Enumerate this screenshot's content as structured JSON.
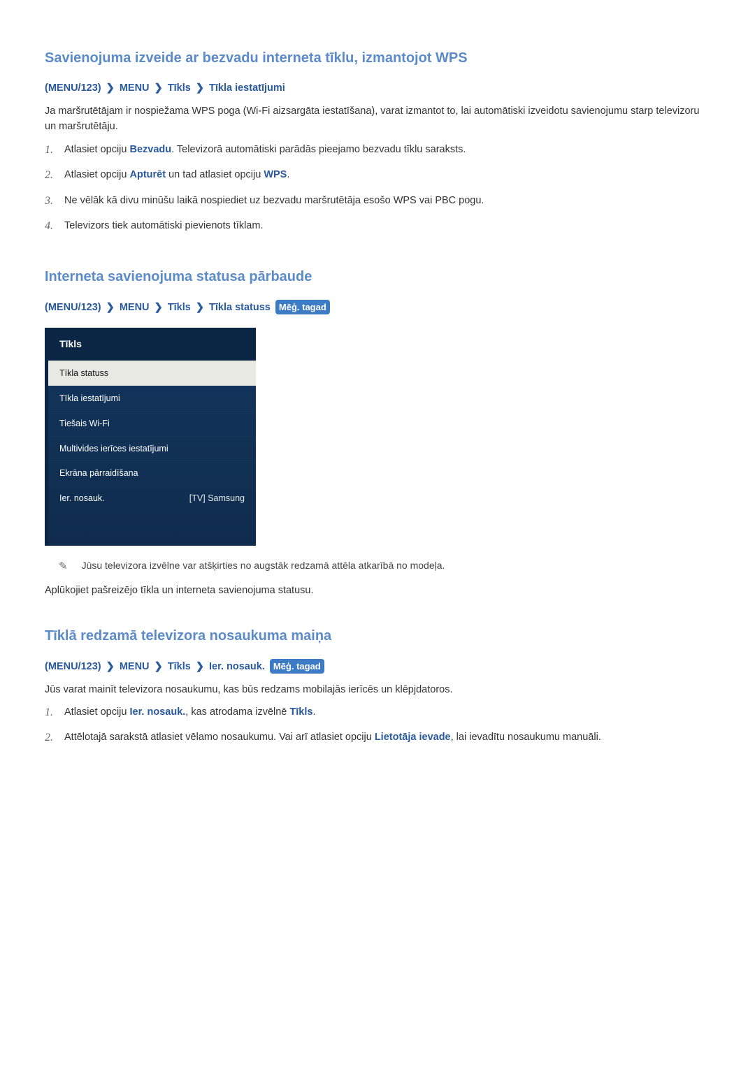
{
  "section1": {
    "title": "Savienojuma izveide ar bezvadu interneta tīklu, izmantojot WPS",
    "breadcrumb_prefix": "(",
    "breadcrumb_first": "MENU/123",
    "breadcrumb_suffix": ")",
    "bc_menu": "MENU",
    "bc_tikls": "Tīkls",
    "bc_last": "Tīkla iestatījumi",
    "intro": "Ja maršrutētājam ir nospiežama WPS poga (Wi-Fi aizsargāta iestatīšana), varat izmantot to, lai automātiski izveidotu savienojumu starp televizoru un maršrutētāju.",
    "steps": [
      {
        "n": "1.",
        "pre": "Atlasiet opciju ",
        "bold": "Bezvadu",
        "post": ". Televizorā automātiski parādās pieejamo bezvadu tīklu saraksts."
      },
      {
        "n": "2.",
        "pre": "Atlasiet opciju ",
        "bold": "Apturēt",
        "mid": " un tad atlasiet opciju ",
        "bold2": "WPS",
        "post": "."
      },
      {
        "n": "3.",
        "text": "Ne vēlāk kā divu minūšu laikā nospiediet uz bezvadu maršrutētāja esošo WPS vai PBC pogu."
      },
      {
        "n": "4.",
        "text": "Televizors tiek automātiski pievienots tīklam."
      }
    ]
  },
  "section2": {
    "title": "Interneta savienojuma statusa pārbaude",
    "breadcrumb_prefix": "(",
    "breadcrumb_first": "MENU/123",
    "breadcrumb_suffix": ")",
    "bc_menu": "MENU",
    "bc_tikls": "Tīkls",
    "bc_last": "Tīkla statuss",
    "try_now": "Mēģ. tagad",
    "menu": {
      "panel_title": "Tīkls",
      "items": [
        {
          "label": "Tīkla statuss",
          "right": "",
          "selected": true
        },
        {
          "label": "Tīkla iestatījumi",
          "right": "",
          "selected": false
        },
        {
          "label": "Tiešais Wi-Fi",
          "right": "",
          "selected": false
        },
        {
          "label": "Multivides ierīces iestatījumi",
          "right": "",
          "selected": false
        },
        {
          "label": "Ekrāna pārraidīšana",
          "right": "",
          "selected": false
        },
        {
          "label": "Ier. nosauk.",
          "right": "[TV] Samsung",
          "selected": false
        }
      ]
    },
    "note": "Jūsu televizora izvēlne var atšķirties no augstāk redzamā attēla atkarībā no modeļa.",
    "body": "Aplūkojiet pašreizējo tīkla un interneta savienojuma statusu."
  },
  "section3": {
    "title": "Tīklā redzamā televizora nosaukuma maiņa",
    "breadcrumb_prefix": "(",
    "breadcrumb_first": "MENU/123",
    "breadcrumb_suffix": ")",
    "bc_menu": "MENU",
    "bc_tikls": "Tīkls",
    "bc_last": "Ier. nosauk.",
    "try_now": "Mēģ. tagad",
    "body": "Jūs varat mainīt televizora nosaukumu, kas būs redzams mobilajās ierīcēs un klēpjdatoros.",
    "steps": [
      {
        "n": "1.",
        "pre": "Atlasiet opciju ",
        "bold": "Ier. nosauk.",
        "mid": ", kas atrodama izvēlnē ",
        "bold2": "Tīkls",
        "post": "."
      },
      {
        "n": "2.",
        "pre": "Attēlotajā sarakstā atlasiet vēlamo nosaukumu. Vai arī atlasiet opciju ",
        "bold": "Lietotāja ievade",
        "post": ", lai ievadītu nosaukumu manuāli."
      }
    ]
  }
}
